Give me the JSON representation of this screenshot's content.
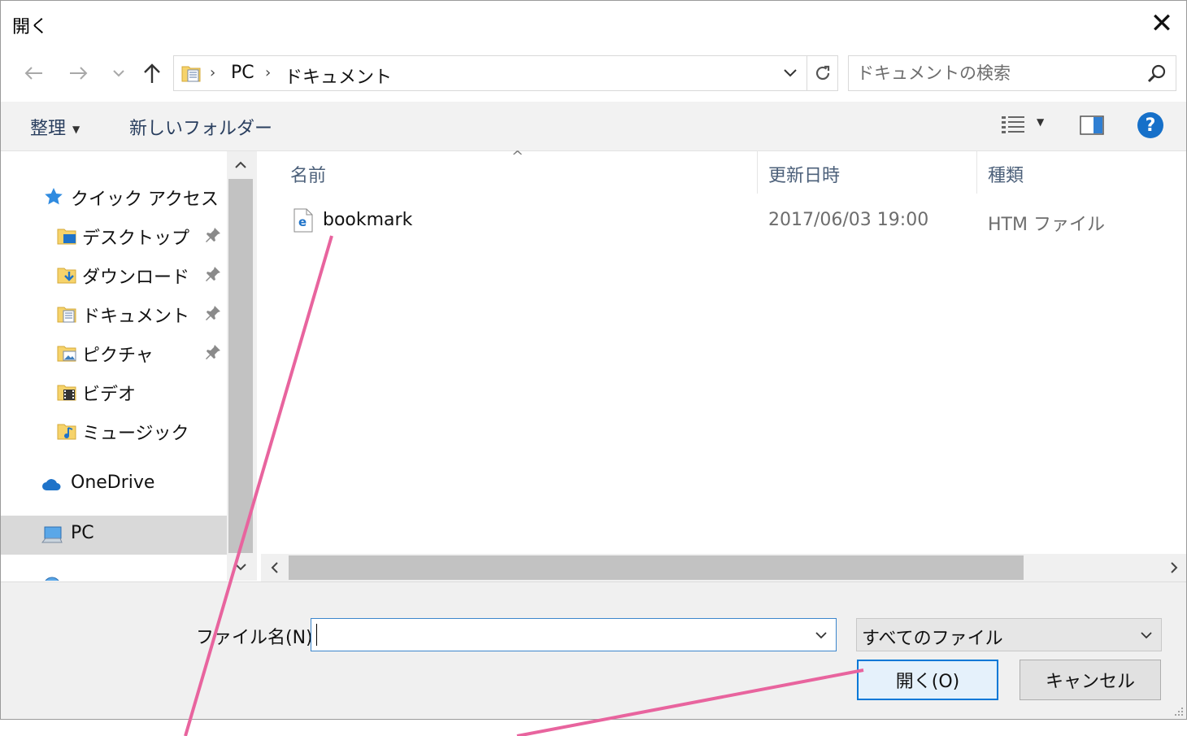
{
  "window": {
    "title": "開く",
    "close_glyph": "✕"
  },
  "nav": {
    "breadcrumbs": [
      "PC",
      "ドキュメント"
    ],
    "search_placeholder": "ドキュメントの検索"
  },
  "toolbar": {
    "organize_label": "整理",
    "new_folder_label": "新しいフォルダー",
    "help_label": "?"
  },
  "sidebar": {
    "quick_access": "クイック アクセス",
    "items": [
      {
        "label": "デスクトップ",
        "icon": "desktop-folder-icon",
        "pinned": true
      },
      {
        "label": "ダウンロード",
        "icon": "downloads-folder-icon",
        "pinned": true
      },
      {
        "label": "ドキュメント",
        "icon": "documents-folder-icon",
        "pinned": true
      },
      {
        "label": "ピクチャ",
        "icon": "pictures-folder-icon",
        "pinned": true
      },
      {
        "label": "ビデオ",
        "icon": "videos-folder-icon",
        "pinned": false
      },
      {
        "label": "ミュージック",
        "icon": "music-folder-icon",
        "pinned": false
      }
    ],
    "onedrive": "OneDrive",
    "pc": "PC"
  },
  "filelist": {
    "columns": [
      "名前",
      "更新日時",
      "種類"
    ],
    "rows": [
      {
        "name": "bookmark",
        "modified": "2017/06/03 19:00",
        "type": "HTM ファイル"
      }
    ]
  },
  "footer": {
    "filename_label": "ファイル名(N):",
    "filename_value": "",
    "filetype_value": "すべてのファイル",
    "open_label": "開く(O)",
    "cancel_label": "キャンセル"
  },
  "colors": {
    "accent": "#0078d7",
    "annotation": "#e8649e",
    "selected_bg": "#d9d9d9",
    "toolbar_bg": "#f2f2f2"
  }
}
